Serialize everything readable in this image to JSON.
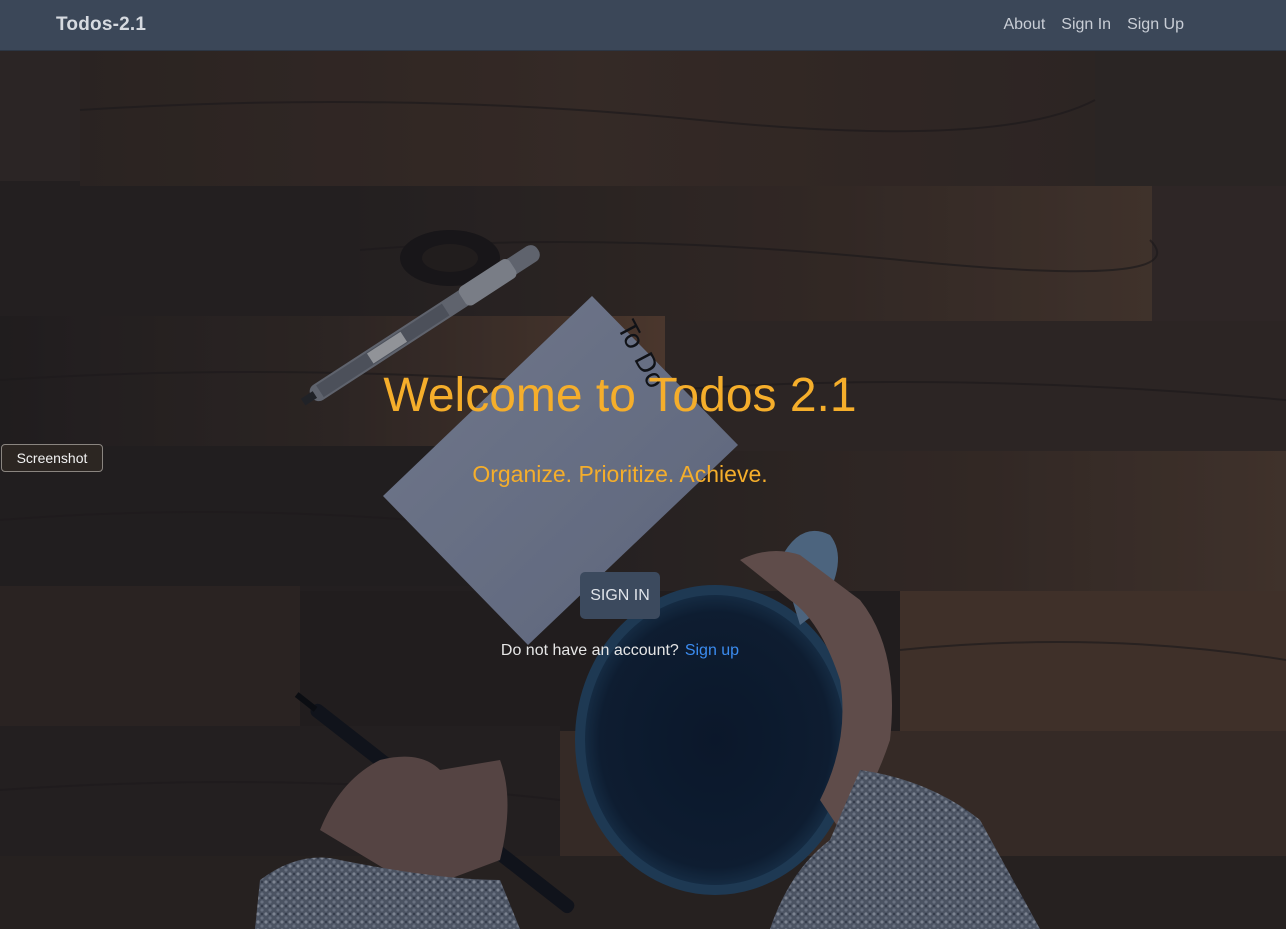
{
  "navbar": {
    "brand": "Todos-2.1",
    "links": [
      "About",
      "Sign In",
      "Sign Up"
    ]
  },
  "hero": {
    "title": "Welcome to Todos 2.1",
    "subtitle": "Organize. Prioritize. Achieve.",
    "signin_label": "SIGN IN",
    "account_prompt": "Do not have an account?",
    "signup_link": "Sign up"
  },
  "note": {
    "text": "To Do"
  },
  "overlay": {
    "screenshot_label": "Screenshot"
  },
  "colors": {
    "navbar": "#3b4758",
    "accent": "#f5ae2b",
    "button": "#3c4a5e",
    "link": "#3b8cf0",
    "wood_dark": "#2b2520"
  }
}
